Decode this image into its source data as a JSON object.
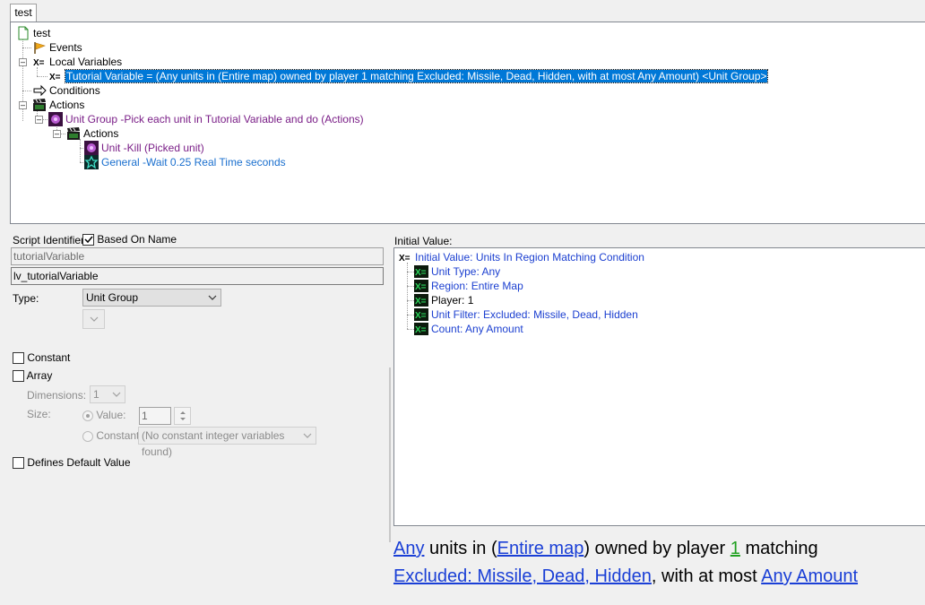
{
  "tab": {
    "label": "test"
  },
  "tree": {
    "root": "test",
    "events": "Events",
    "local_variables": "Local Variables",
    "variable_line": "Tutorial Variable = (Any units in (Entire map) owned by player 1 matching Excluded: Missile, Dead, Hidden, with at most Any Amount) <Unit Group>",
    "conditions": "Conditions",
    "actions": "Actions",
    "unit_group_action": "Unit Group -Pick each unit in Tutorial Variable and do (Actions)",
    "sub_actions": "Actions",
    "kill_action": "Unit -Kill (Picked unit)",
    "wait_action": "General -Wait 0.25 Real Time seconds"
  },
  "props": {
    "script_identifier_label": "Script Identifier:",
    "based_on_name_label": "Based On Name",
    "based_on_name_checked": true,
    "identifier_value": "tutorialVariable",
    "full_identifier": "lv_tutorialVariable",
    "type_label": "Type:",
    "type_value": "Unit Group",
    "constant_label": "Constant",
    "array_label": "Array",
    "dimensions_label": "Dimensions:",
    "dimensions_value": "1",
    "size_label": "Size:",
    "value_label": "Value:",
    "value_number": "1",
    "constant_radio_label": "Constant:",
    "constant_combo_value": "(No constant integer variables found)",
    "defines_default_label": "Defines Default Value"
  },
  "initial_value": {
    "label": "Initial Value:",
    "root": "Initial Value: Units In Region Matching Condition",
    "params": [
      {
        "name": "Unit Type:",
        "value": "Any"
      },
      {
        "name": "Region:",
        "value": "Entire Map"
      },
      {
        "name": "Player:",
        "value": "1"
      },
      {
        "name": "Unit Filter:",
        "value": "Excluded: Missile, Dead, Hidden"
      },
      {
        "name": "Count:",
        "value": "Any Amount"
      }
    ]
  },
  "description": {
    "t1": "Any",
    "t2": " units in (",
    "t3": "Entire map",
    "t4": ") owned by player ",
    "t5": "1",
    "t6": " matching",
    "t7": "Excluded: Missile, Dead, Hidden",
    "t8": ", with at most ",
    "t9": "Any Amount"
  }
}
